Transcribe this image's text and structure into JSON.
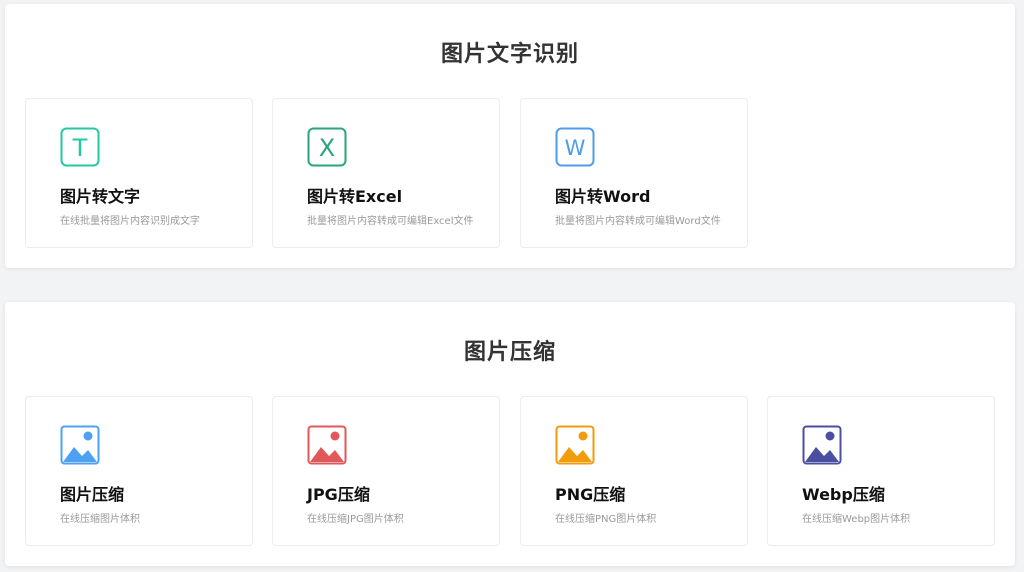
{
  "sections": [
    {
      "title": "图片文字识别",
      "cards": [
        {
          "title": "图片转文字",
          "desc": "在线批量将图片内容识别成文字",
          "icon": "text-t-icon",
          "letter": "T",
          "color": "#20c9a0"
        },
        {
          "title": "图片转Excel",
          "desc": "批量将图片内容转成可编辑Excel文件",
          "icon": "excel-x-icon",
          "letter": "X",
          "color": "#2aa57a"
        },
        {
          "title": "图片转Word",
          "desc": "批量将图片内容转成可编辑Word文件",
          "icon": "word-w-icon",
          "letter": "W",
          "color": "#4d9de8"
        }
      ]
    },
    {
      "title": "图片压缩",
      "cards": [
        {
          "title": "图片压缩",
          "desc": "在线压缩图片体积",
          "icon": "image-icon",
          "color": "#4da1f0"
        },
        {
          "title": "JPG压缩",
          "desc": "在线压缩JPG图片体积",
          "icon": "image-icon",
          "color": "#e0585a"
        },
        {
          "title": "PNG压缩",
          "desc": "在线压缩PNG图片体积",
          "icon": "image-icon",
          "color": "#f29b0c"
        },
        {
          "title": "Webp压缩",
          "desc": "在线压缩Webp图片体积",
          "icon": "image-icon",
          "color": "#4b4f9f"
        }
      ]
    }
  ]
}
